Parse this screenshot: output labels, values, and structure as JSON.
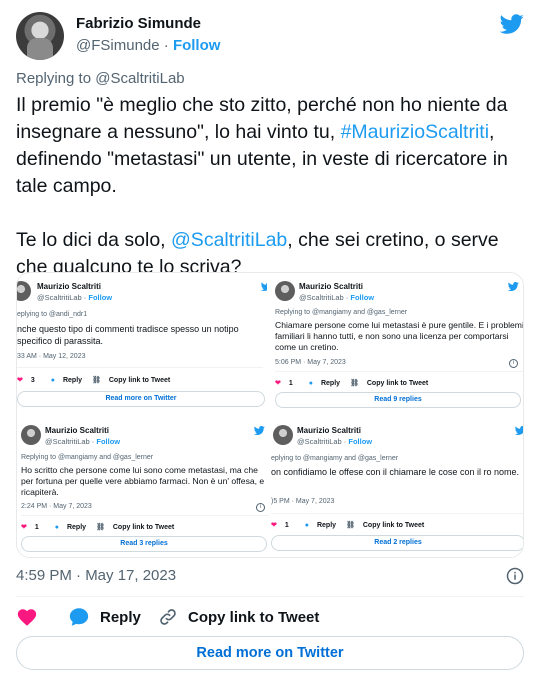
{
  "author": {
    "name": "Fabrizio Simunde",
    "handle": "@FSimunde",
    "separator": "·",
    "follow_label": "Follow"
  },
  "replying_to": "Replying to @ScaltritiLab",
  "tweet": {
    "line1_pre": "Il premio \"è meglio che sto zitto, perché non ho niente da insegnare a nessuno\", lo hai vinto tu, ",
    "line1_link": "#MaurizioScaltriti",
    "line1_post": ", definendo \"metastasi\" un utente, in veste di ricercatore in tale campo.",
    "line2_pre": "Te lo dici da solo, ",
    "line2_link": "@ScaltritiLab",
    "line2_post": ",  che sei cretino, o serve che qualcuno te lo scriva?"
  },
  "embedded": [
    {
      "name": "Maurizio Scaltriti",
      "handle": "@ScaltritiLab",
      "follow": "Follow",
      "replying": "eplying to @andi_ndr1",
      "text": "nche questo tipo di commenti tradisce spesso un notipo specifico di parassita.",
      "date": "33 AM · May 12, 2023",
      "likes": "3",
      "reply_label": "Reply",
      "copy_label": "Copy link to Tweet",
      "button": "Read more on Twitter"
    },
    {
      "name": "Maurizio Scaltriti",
      "handle": "@ScaltritiLab",
      "follow": "Follow",
      "replying": "Replying to @mangiamy and @gas_lerner",
      "text": "Chiamare persone come lui metastasi è pure gentile. E i problemi familiari li hanno tutti, e non sono una licenza per comportarsi come un cretino.",
      "date": "5:06 PM · May 7, 2023",
      "likes": "1",
      "reply_label": "Reply",
      "copy_label": "Copy link to Tweet",
      "button": "Read 9 replies"
    },
    {
      "name": "Maurizio Scaltriti",
      "handle": "@ScaltritiLab",
      "follow": "Follow",
      "replying": "Replying to @mangiamy and @gas_lerner",
      "text": "Ho scritto che persone come lui sono come metastasi, ma che per fortuna per quelle vere abbiamo farmaci. Non è un' offesa, e ricapiterà.",
      "date": "2:24 PM · May 7, 2023",
      "likes": "1",
      "reply_label": "Reply",
      "copy_label": "Copy link to Tweet",
      "button": "Read 3 replies"
    },
    {
      "name": "Maurizio Scaltriti",
      "handle": "@ScaltritiLab",
      "follow": "Follow",
      "replying": "eplying to @mangiamy and @gas_lerner",
      "text": "on confidiamo le offese con il chiamare le cose con il ro nome.",
      "date": ")5 PM · May 7, 2023",
      "likes": "1",
      "reply_label": "Reply",
      "copy_label": "Copy link to Tweet",
      "button": "Read 2 replies"
    }
  ],
  "timestamp": "4:59 PM · May 17, 2023",
  "actions": {
    "reply_label": "Reply",
    "copy_label": "Copy link to Tweet"
  },
  "read_more_label": "Read more on Twitter",
  "colors": {
    "accent": "#1d9bf0",
    "like": "#f91880",
    "muted": "#536471",
    "text": "#0f1419",
    "button_text": "#006fd6"
  },
  "icons": [
    "twitter-bird-icon",
    "info-icon",
    "heart-icon",
    "reply-bubble-icon",
    "link-icon"
  ]
}
